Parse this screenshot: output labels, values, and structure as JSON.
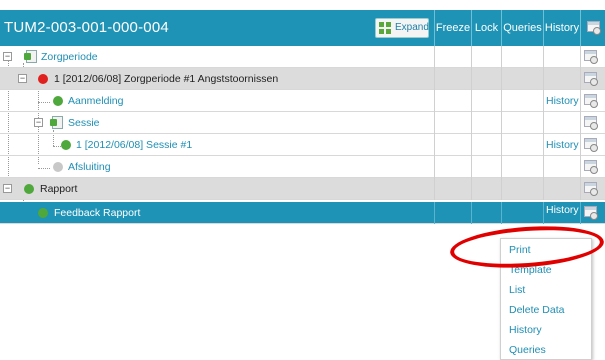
{
  "header": {
    "title": "TUM2-003-001-000-004",
    "expand_label": "Expand",
    "columns": [
      "Freeze",
      "Lock",
      "Queries",
      "History"
    ]
  },
  "rows": [
    {
      "label": "Zorgperiode",
      "status": "",
      "history": ""
    },
    {
      "label": "1 [2012/06/08] Zorgperiode #1 Angststoornissen",
      "status": "red",
      "history": ""
    },
    {
      "label": "Aanmelding",
      "status": "green",
      "history": "History"
    },
    {
      "label": "Sessie",
      "status": "",
      "history": ""
    },
    {
      "label": "1 [2012/06/08] Sessie #1",
      "status": "green",
      "history": "History"
    },
    {
      "label": "Afsluiting",
      "status": "gray",
      "history": ""
    },
    {
      "label": "Rapport",
      "status": "green",
      "history": ""
    },
    {
      "label": "Feedback Rapport",
      "status": "green",
      "history": "History"
    }
  ],
  "context_menu": {
    "items": [
      "Print",
      "Template",
      "List",
      "Delete Data",
      "History",
      "Queries"
    ],
    "highlighted": "Print"
  },
  "colors": {
    "header_bg": "#1f93b6",
    "selected_row_bg": "#1f93b6",
    "link": "#1f8fb4",
    "status_green": "#4fa83b",
    "status_red": "#e0201e",
    "annotation_ring": "#e00000"
  }
}
